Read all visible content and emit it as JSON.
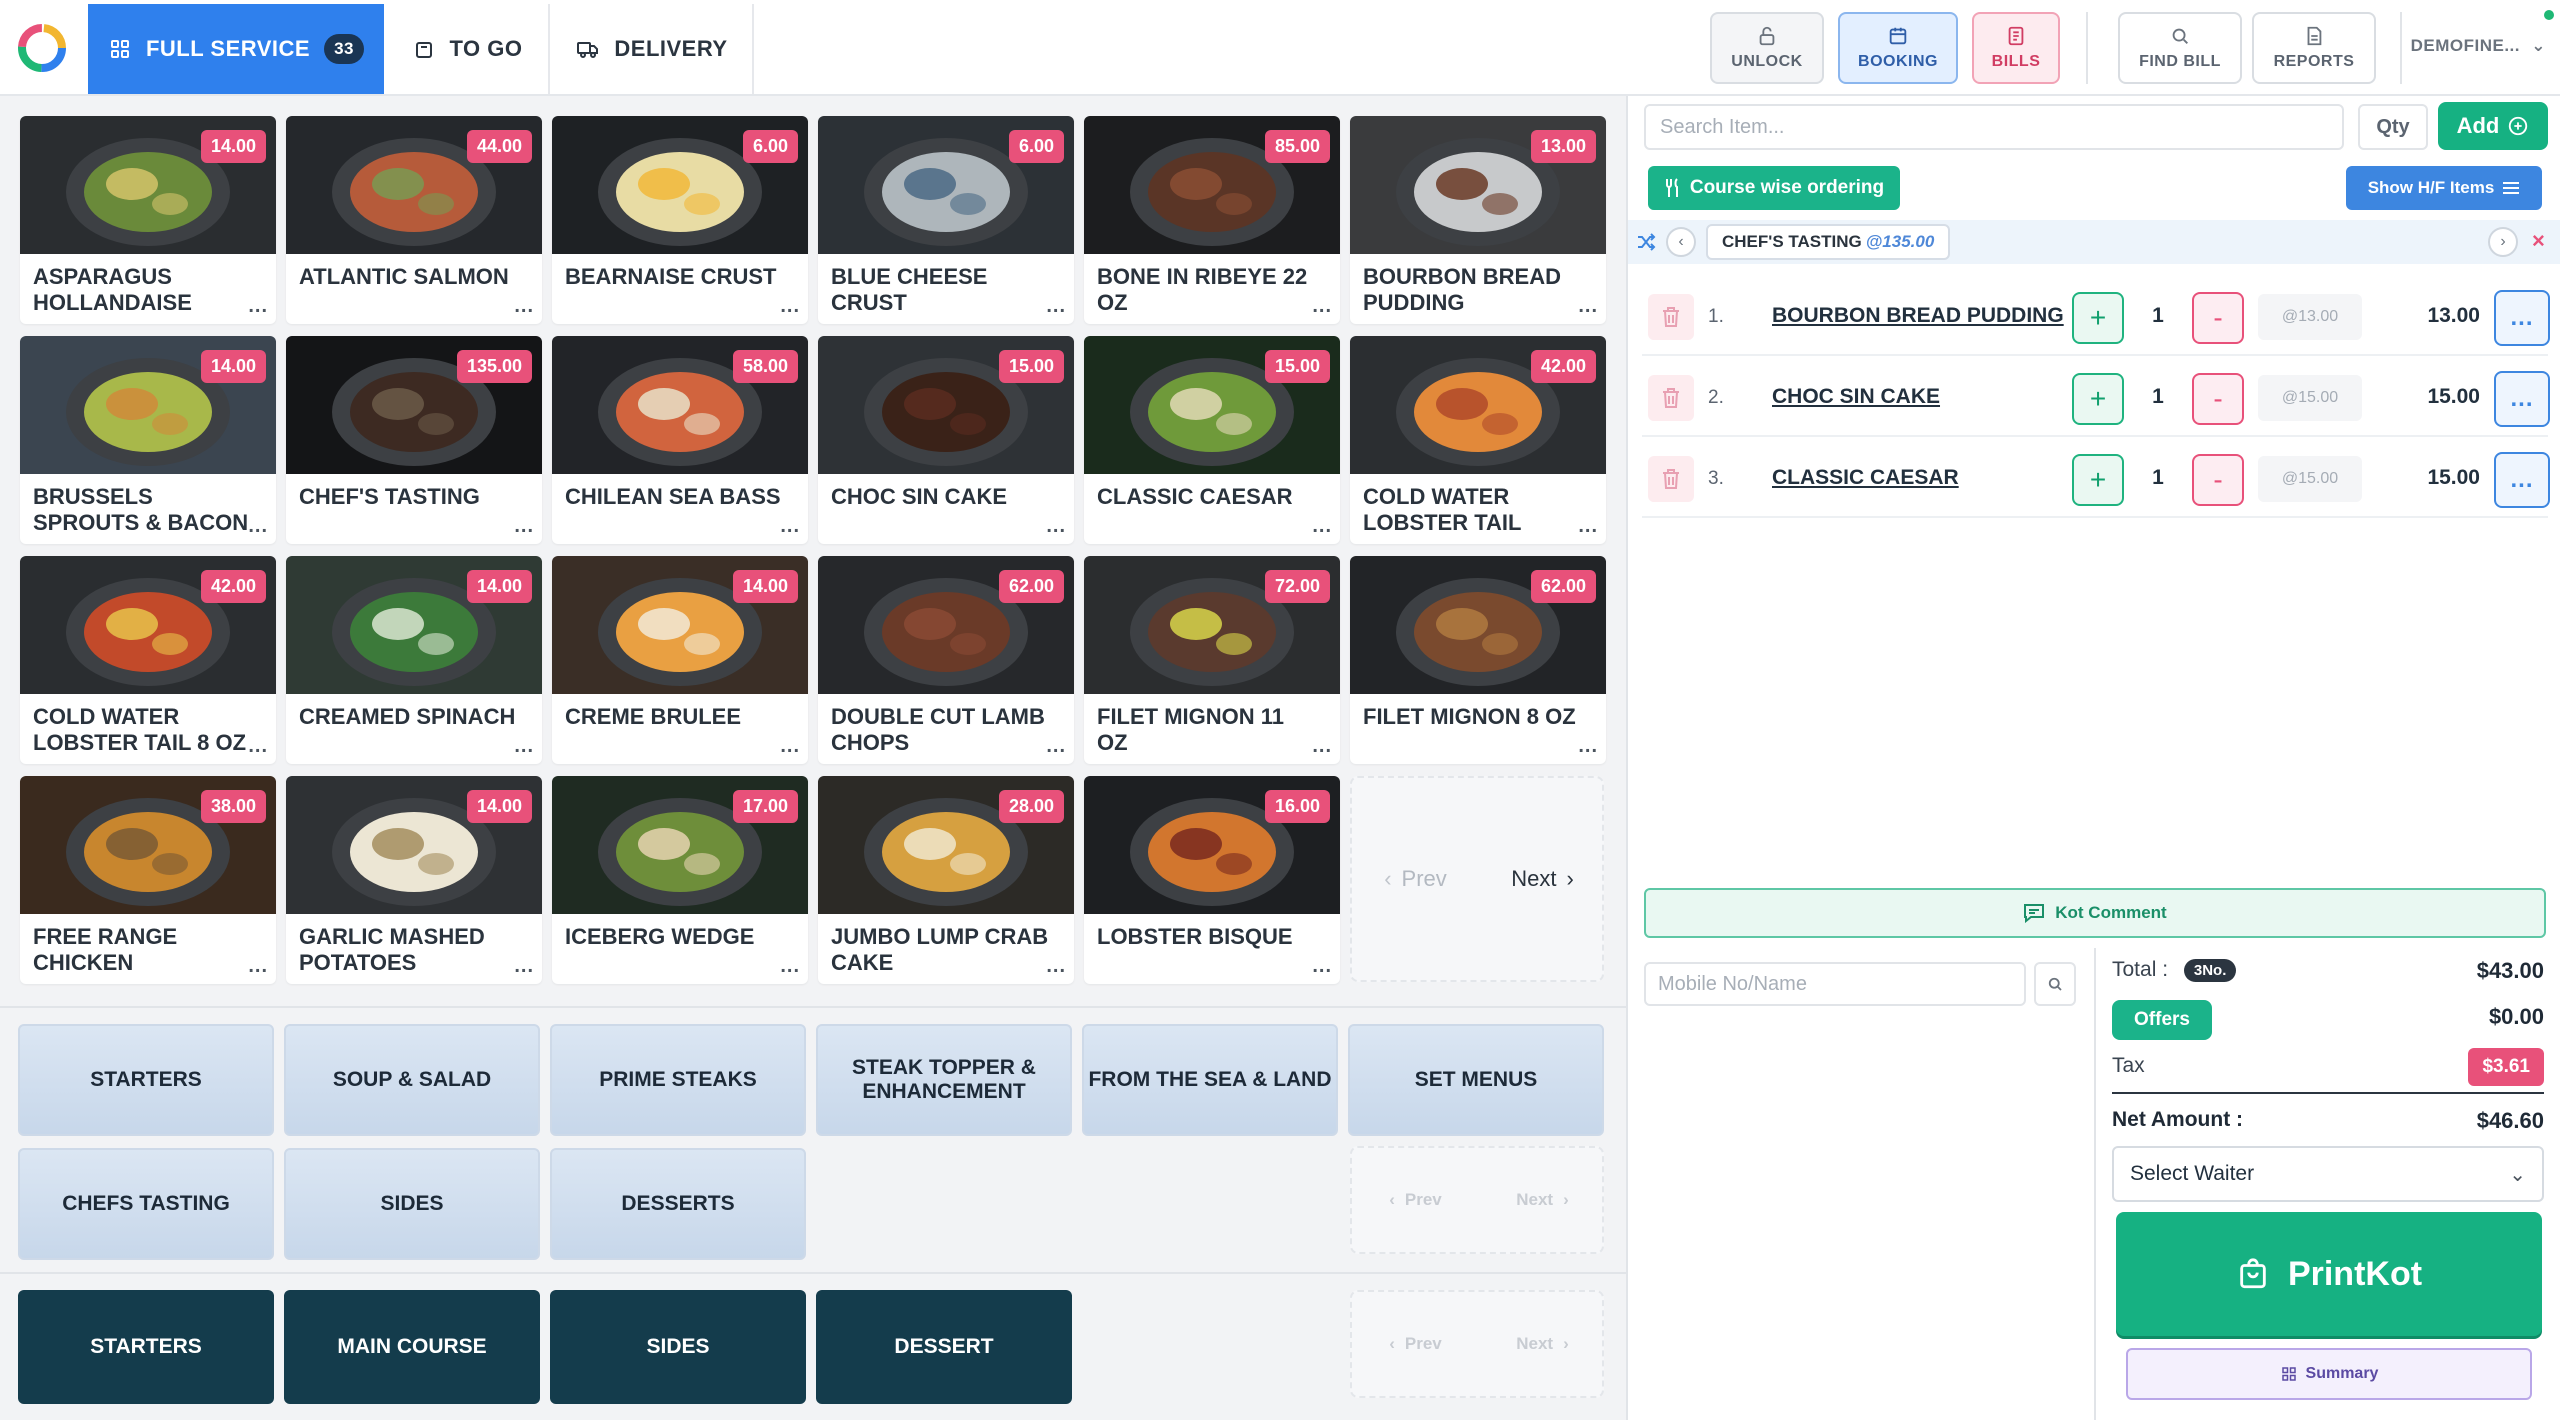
{
  "order_types": [
    {
      "label": "FULL SERVICE",
      "count": "33"
    },
    {
      "label": "TO GO"
    },
    {
      "label": "DELIVERY"
    }
  ],
  "toolbar": {
    "unlock": "UNLOCK",
    "booking": "BOOKING",
    "bills": "BILLS",
    "find_bill": "FIND BILL",
    "reports": "REPORTS",
    "user": "DEMOFINE..."
  },
  "products": [
    {
      "name": "ASPARAGUS HOLLANDAISE",
      "price": "14.00"
    },
    {
      "name": "ATLANTIC SALMON",
      "price": "44.00"
    },
    {
      "name": "BEARNAISE CRUST",
      "price": "6.00"
    },
    {
      "name": "BLUE CHEESE CRUST",
      "price": "6.00"
    },
    {
      "name": "BONE IN RIBEYE 22 Oz",
      "price": "85.00"
    },
    {
      "name": "BOURBON BREAD PUDDING",
      "price": "13.00"
    },
    {
      "name": "BRUSSELS SPROUTS & BACON",
      "price": "14.00"
    },
    {
      "name": "CHEF'S TASTING",
      "price": "135.00"
    },
    {
      "name": "CHILEAN SEA BASS",
      "price": "58.00"
    },
    {
      "name": "CHOC SIN CAKE",
      "price": "15.00"
    },
    {
      "name": "CLASSIC CAESAR",
      "price": "15.00"
    },
    {
      "name": "COLD WATER LOBSTER TAIL",
      "price": "42.00"
    },
    {
      "name": "COLD WATER LOBSTER TAIL 8 Oz",
      "price": "42.00"
    },
    {
      "name": "CREAMED SPINACH",
      "price": "14.00"
    },
    {
      "name": "CREME BRULEE",
      "price": "14.00"
    },
    {
      "name": "DOUBLE CUT LAMB CHOPS",
      "price": "62.00"
    },
    {
      "name": "FILET MIGNON 11 Oz",
      "price": "72.00"
    },
    {
      "name": "FILET MIGNON 8 Oz",
      "price": "62.00"
    },
    {
      "name": "FREE RANGE CHICKEN",
      "price": "38.00"
    },
    {
      "name": "GARLIC MASHED POTATOES",
      "price": "14.00"
    },
    {
      "name": "ICEBERG WEDGE",
      "price": "17.00"
    },
    {
      "name": "JUMBO LUMP CRAB CAKE",
      "price": "28.00"
    },
    {
      "name": "LOBSTER BISQUE",
      "price": "16.00"
    }
  ],
  "more_label": "...",
  "pager": {
    "prev": "Prev",
    "next": "Next"
  },
  "categories": [
    "STARTERS",
    "SOUP & SALAD",
    "PRIME STEAKS",
    "STEAK TOPPER & ENHANCEMENT",
    "FROM THE SEA & LAND",
    "SET MENUS",
    "CHEFS TASTING",
    "SIDES",
    "DESSERTS"
  ],
  "courses": [
    "STARTERS",
    "MAIN COURSE",
    "SIDES",
    "DESSERT"
  ],
  "order_panel": {
    "search_placeholder": "Search Item...",
    "qty": "Qty",
    "add": "Add",
    "course_wise": "Course wise ordering",
    "show_hf": "Show H/F Items",
    "set_menu": "CHEF'S TASTING",
    "set_menu_price": "@135.00",
    "items": [
      {
        "no": "1.",
        "name": "BOURBON BREAD PUDDING",
        "qty": "1",
        "rate": "@13.00",
        "amount": "13.00"
      },
      {
        "no": "2.",
        "name": "CHOC SIN CAKE",
        "qty": "1",
        "rate": "@15.00",
        "amount": "15.00"
      },
      {
        "no": "3.",
        "name": "CLASSIC CAESAR",
        "qty": "1",
        "rate": "@15.00",
        "amount": "15.00"
      }
    ],
    "row_more": "...",
    "kot_comment": "Kot Comment",
    "mobile_placeholder": "Mobile No/Name"
  },
  "summary": {
    "total_label": "Total :",
    "count": "3No.",
    "total": "$43.00",
    "offers": "Offers",
    "offers_value": "$0.00",
    "tax_label": "Tax",
    "tax": "$3.61",
    "net_label": "Net Amount :",
    "net": "$46.60",
    "waiter": "Select Waiter",
    "printkot": "PrintKot",
    "summary_btn": "Summary"
  },
  "colors": {
    "accent": "#2f80ed",
    "green": "#16b182",
    "pink": "#e8517a",
    "course": "#143c4c"
  }
}
